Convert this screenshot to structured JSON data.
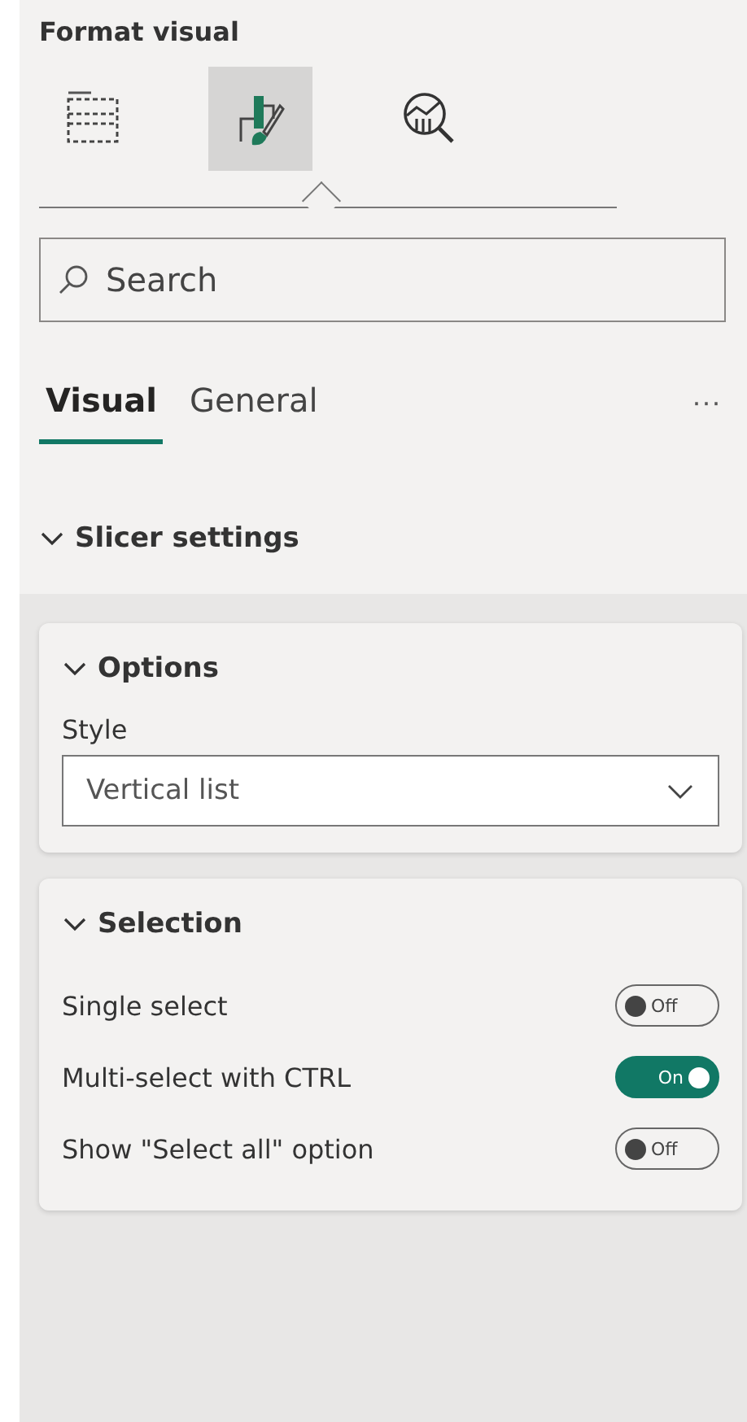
{
  "pane": {
    "title": "Format visual"
  },
  "pane_tabs": [
    {
      "kind": "build",
      "selected": false
    },
    {
      "kind": "format",
      "selected": true
    },
    {
      "kind": "analytics",
      "selected": false
    }
  ],
  "search": {
    "placeholder": "Search"
  },
  "tabs": [
    {
      "label": "Visual",
      "selected": true
    },
    {
      "label": "General",
      "selected": false
    }
  ],
  "more": "···",
  "section": {
    "title": "Slicer settings",
    "expanded": true
  },
  "options": {
    "title": "Options",
    "expanded": true,
    "style_label": "Style",
    "style_value": "Vertical list"
  },
  "selection": {
    "title": "Selection",
    "expanded": true,
    "toggles": [
      {
        "label": "Single select",
        "on": false,
        "text": "Off"
      },
      {
        "label": "Multi-select with CTRL",
        "on": true,
        "text": "On"
      },
      {
        "label": "Show \"Select all\" option",
        "on": false,
        "text": "Off"
      }
    ]
  }
}
